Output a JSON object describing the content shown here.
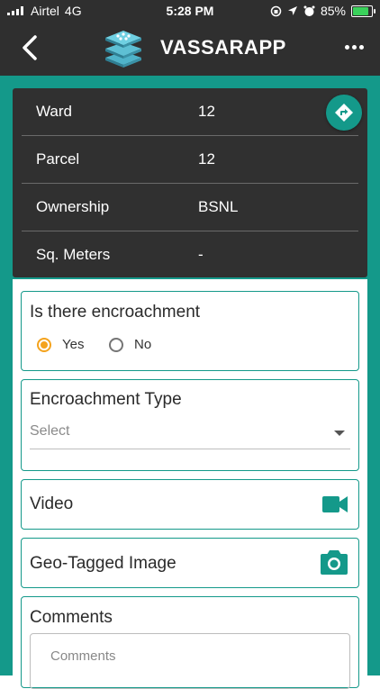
{
  "status_bar": {
    "carrier": "Airtel",
    "network": "4G",
    "time": "5:28 PM",
    "battery": "85%",
    "battery_level": 0.85
  },
  "app_bar": {
    "title": "VASSARAPP",
    "back_icon": "back-arrow-icon",
    "menu_icon": "more-horizontal-icon"
  },
  "info": {
    "rows": [
      {
        "label": "Ward",
        "value": "12"
      },
      {
        "label": "Parcel",
        "value": "12"
      },
      {
        "label": "Ownership",
        "value": "BSNL"
      },
      {
        "label": "Sq. Meters",
        "value": "-"
      }
    ],
    "directions_icon": "directions-icon"
  },
  "form": {
    "encroachment": {
      "question": "Is there encroachment",
      "options": [
        "Yes",
        "No"
      ],
      "selected": "Yes"
    },
    "encroachment_type": {
      "label": "Encroachment Type",
      "select_value": "Select"
    },
    "video": {
      "label": "Video",
      "icon": "video-camera-icon"
    },
    "geo_image": {
      "label": "Geo-Tagged Image",
      "icon": "camera-icon"
    },
    "comments": {
      "label": "Comments",
      "placeholder": "Comments"
    }
  },
  "colors": {
    "accent": "#14998a",
    "radio_selected": "#f4a31d",
    "dark_bar": "#2f2f2f"
  }
}
